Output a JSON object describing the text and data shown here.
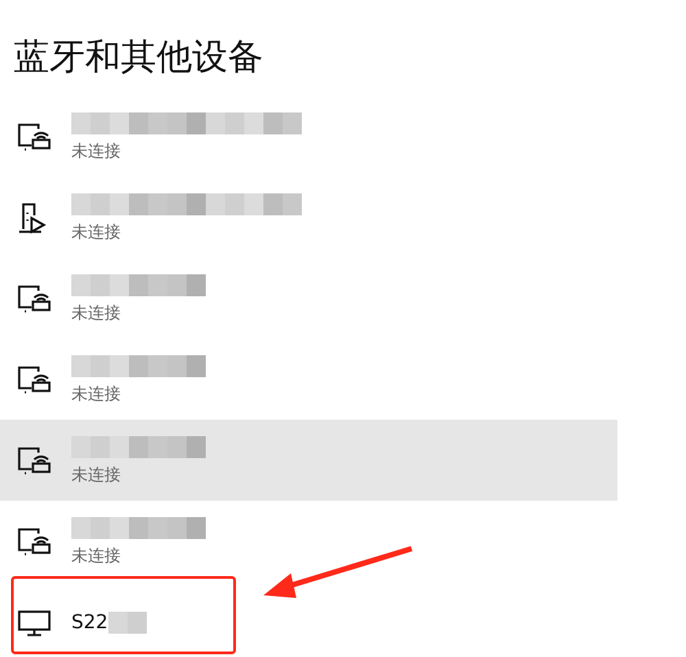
{
  "title": "蓝牙和其他设备",
  "devices": [
    {
      "kind": "cast",
      "status": "未连接",
      "hovered": false,
      "highlighted": false
    },
    {
      "kind": "media",
      "status": "未连接",
      "hovered": false,
      "highlighted": false
    },
    {
      "kind": "cast",
      "status": "未连接",
      "hovered": false,
      "highlighted": false
    },
    {
      "kind": "cast",
      "status": "未连接",
      "hovered": false,
      "highlighted": false
    },
    {
      "kind": "cast",
      "status": "未连接",
      "hovered": true,
      "highlighted": false
    },
    {
      "kind": "cast",
      "status": "未连接",
      "hovered": false,
      "highlighted": false
    },
    {
      "kind": "monitor",
      "name": "S22",
      "hovered": false,
      "highlighted": true
    }
  ]
}
